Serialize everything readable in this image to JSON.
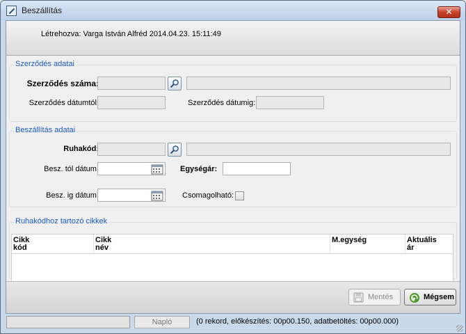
{
  "window": {
    "title": "Beszállítás",
    "close_label": "✕"
  },
  "header": {
    "created_text": "Létrehozva: Varga István Alfréd 2014.04.23. 15:11:49"
  },
  "contract": {
    "legend": "Szerződés adatai",
    "number_label": "Szerződés száma:",
    "number_value": "",
    "name_value": "",
    "date_from_label": "Szerződés dátumtól:",
    "date_from_value": "",
    "date_to_label": "Szerződés dátumig:",
    "date_to_value": ""
  },
  "delivery": {
    "legend": "Beszállítás adatai",
    "code_label": "Ruhakód:",
    "code_value": "",
    "code_desc_value": "",
    "from_date_label": "Besz. tól dátum:",
    "from_date_value": "",
    "to_date_label": "Besz. ig dátum:",
    "to_date_value": "",
    "unit_price_label": "Egységár:",
    "unit_price_value": "",
    "packable_label": "Csomagolható:",
    "packable_checked": false
  },
  "items": {
    "legend": "Ruhakódhoz tartozó cikkek",
    "columns": [
      {
        "line1": "Cikk",
        "line2": "kód"
      },
      {
        "line1": "Cikk",
        "line2": "név"
      },
      {
        "line1": "M.egység",
        "line2": ""
      },
      {
        "line1": "Aktuális",
        "line2": "ár"
      }
    ],
    "rows": []
  },
  "actions": {
    "save_label": "Mentés",
    "cancel_label": "Mégsem"
  },
  "status": {
    "log_label": "Napló",
    "info_text": "(0 rekord, előkészítés: 00p00.150, adatbetöltés: 00p00.000)"
  },
  "colors": {
    "legend": "#1a56c4",
    "frame": "#c9d9ec"
  }
}
